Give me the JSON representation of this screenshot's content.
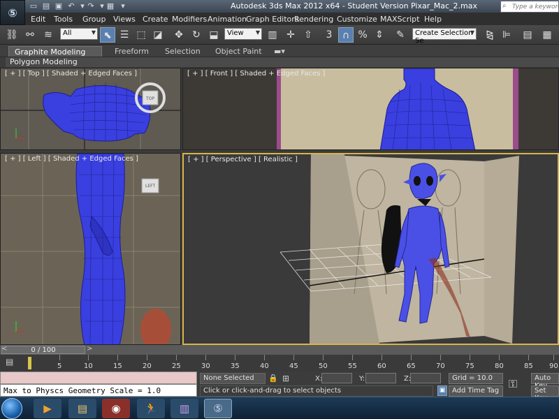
{
  "window": {
    "title": "Autodesk 3ds Max  2012 x64   -  Student Version     Pixar_Mac_2.max",
    "help_search_placeholder": "Type a keyword or phrase"
  },
  "menu": [
    "Edit",
    "Tools",
    "Group",
    "Views",
    "Create",
    "Modifiers",
    "Animation",
    "Graph Editors",
    "Rendering",
    "Customize",
    "MAXScript",
    "Help"
  ],
  "toolbar": {
    "selection_filter": "All",
    "reference_coord": "View",
    "named_selection": "Create Selection Se",
    "snap_value": "3"
  },
  "ribbon": {
    "tabs": [
      "Graphite Modeling Tools",
      "Freeform",
      "Selection",
      "Object Paint"
    ],
    "active_tab": "Graphite Modeling Tools",
    "panel_label": "Polygon Modeling"
  },
  "viewports": {
    "top": "[ + ] [ Top ] [ Shaded + Edged Faces ]",
    "front": "[ + ] [ Front ] [ Shaded + Edged Faces ]",
    "left": "[ + ] [ Left ] [ Shaded + Edged Faces ]",
    "perspective": "[ + ] [ Perspective ] [ Realistic ]",
    "viewcube_top": "TOP",
    "viewcube_left": "LEFT"
  },
  "timeline": {
    "frame_display": "0 / 100",
    "ticks": [
      "5",
      "10",
      "15",
      "20",
      "25",
      "30",
      "35",
      "40",
      "45",
      "50",
      "55",
      "60",
      "65",
      "70",
      "75",
      "80",
      "85",
      "90"
    ]
  },
  "status": {
    "maxscript_output": "Max to Physcs Geometry Scale = 1.0",
    "selection": "None Selected",
    "prompt": "Click or click-and-drag to select objects",
    "x_label": "X:",
    "y_label": "Y:",
    "z_label": "Z:",
    "grid": "Grid = 10.0",
    "add_time_tag": "Add Time Tag",
    "auto_key": "Auto Key",
    "set_key": "Set Key"
  }
}
